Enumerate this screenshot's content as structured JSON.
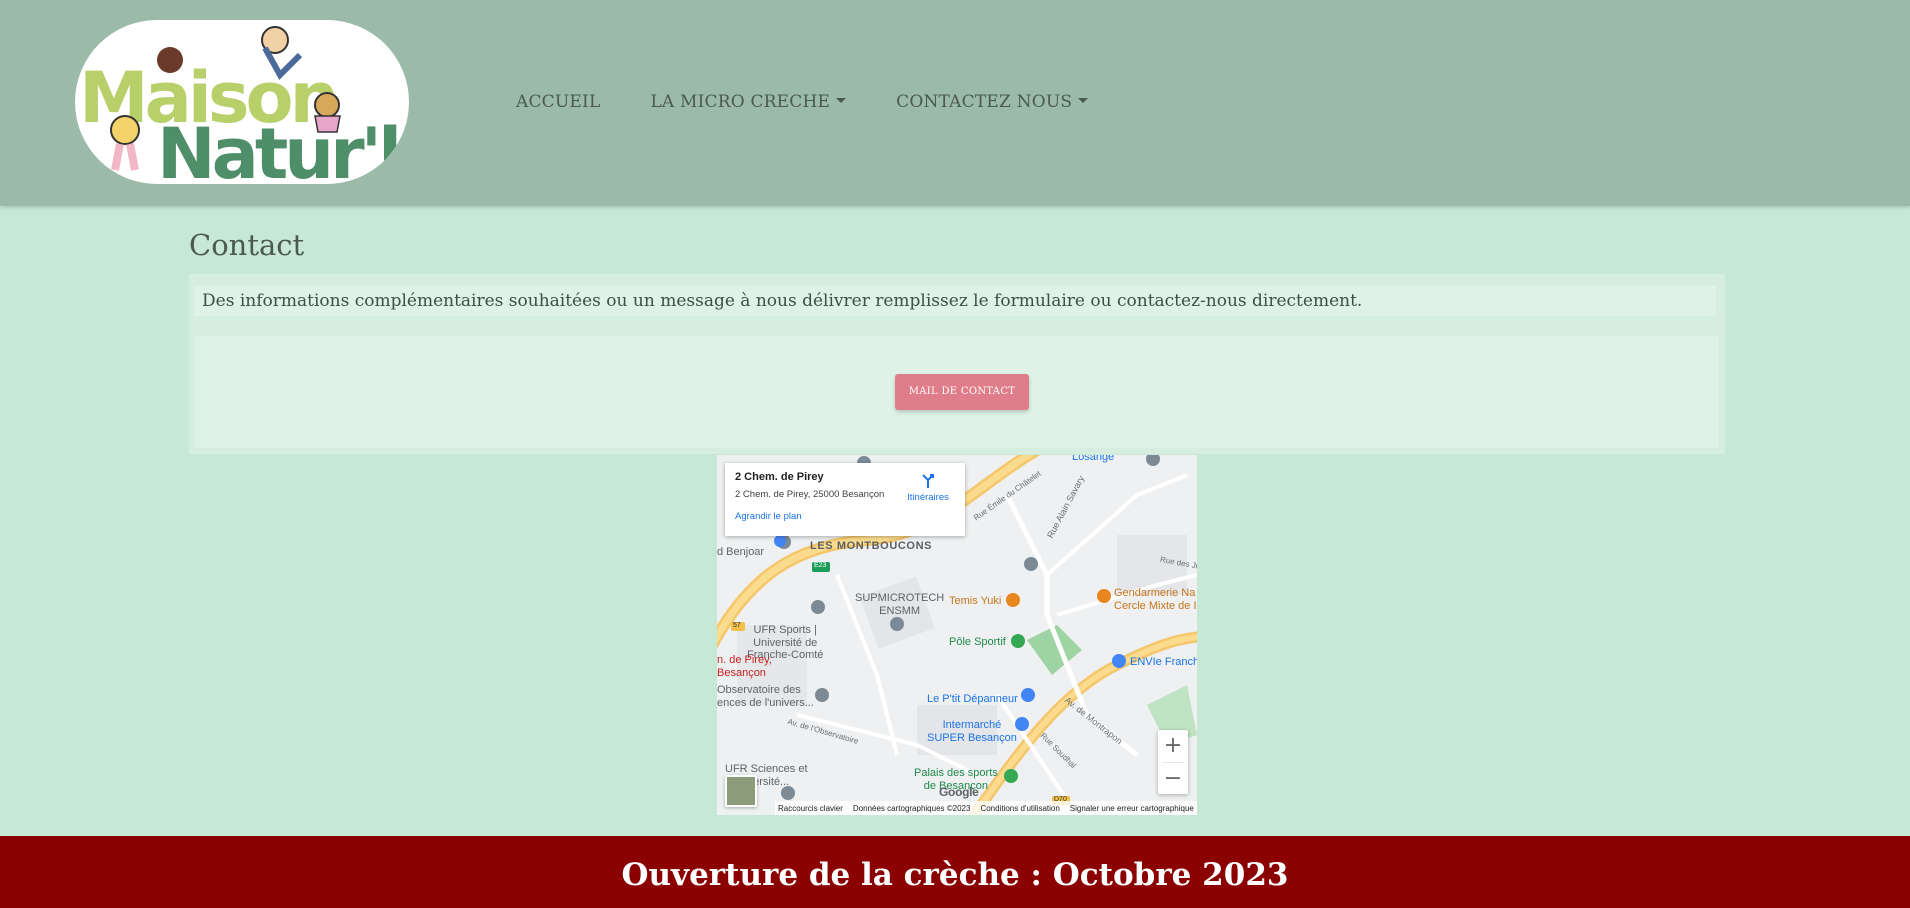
{
  "brand": {
    "logo_alt": "Maison Natur'l",
    "logo_line1": "Maison",
    "logo_line2": "Natur'l"
  },
  "nav": {
    "items": [
      {
        "label": "ACCUEIL",
        "dropdown": false
      },
      {
        "label": "LA MICRO CRECHE",
        "dropdown": true
      },
      {
        "label": "CONTACTEZ NOUS",
        "dropdown": true
      }
    ]
  },
  "contact": {
    "title": "Contact",
    "intro": "Des informations complémentaires souhaitées ou un message à nous délivrer remplissez le formulaire ou contactez-nous directement.",
    "button_label": "MAIL DE CONTACT"
  },
  "map": {
    "place_name": "2 Chem. de Pirey",
    "address": "2 Chem. de Pirey, 25000 Besançon",
    "enlarge_label": "Agrandir le plan",
    "directions_label": "Itinéraires",
    "labels": {
      "losange": "Losange",
      "les_montboucons": "LES MONTBOUCONS",
      "benjoar": "d Benjoar",
      "supmicrotech": "SUPMICROTECH\nENSMM",
      "temis_yuki": "Temis Yuki",
      "gendarmerie": "Gendarmerie Na\nCercle Mixte de I",
      "ufr_sports": "UFR Sports |\nUniversité de\nFranche-Comté",
      "pole_sportif": "Pôle Sportif",
      "envie": "ENVIe Franch",
      "pirey": "n. de Pirey,\nBesançon",
      "observatoire": "Observatoire des\nences de l'univers...",
      "petit_depanneur": "Le P'tit Dépanneur",
      "intermarche": "Intermarché\nSUPER Besançon",
      "palais": "Palais des sports\nde Besançon",
      "ufr_sciences": "UFR Sciences et\n  Université...",
      "rue_alain_savary": "Rue Alain Savary",
      "av_montrapon": "Av. de Montrapon",
      "av_observatoire": "Av. de l'Observatoire",
      "rue_emile": "Rue Émile du Châtelet",
      "rue_soudeur": "Rue Soudhal",
      "rue_des_ju": "Rue des Ju",
      "e23": "E23",
      "d70": "D70",
      "r57": "57"
    },
    "zoom_in": "+",
    "zoom_out": "−",
    "google": "Google",
    "footer": {
      "shortcuts": "Raccourcis clavier",
      "data": "Données cartographiques ©2023",
      "terms": "Conditions d'utilisation",
      "report": "Signaler une erreur cartographique"
    }
  },
  "banner": {
    "text": "Ouverture de la crèche : Octobre 2023"
  },
  "colors": {
    "header_bg": "#9bbaa8",
    "page_bg": "#c6e8d5",
    "button_bg": "#e07d8a",
    "banner_bg": "#8b0000"
  }
}
